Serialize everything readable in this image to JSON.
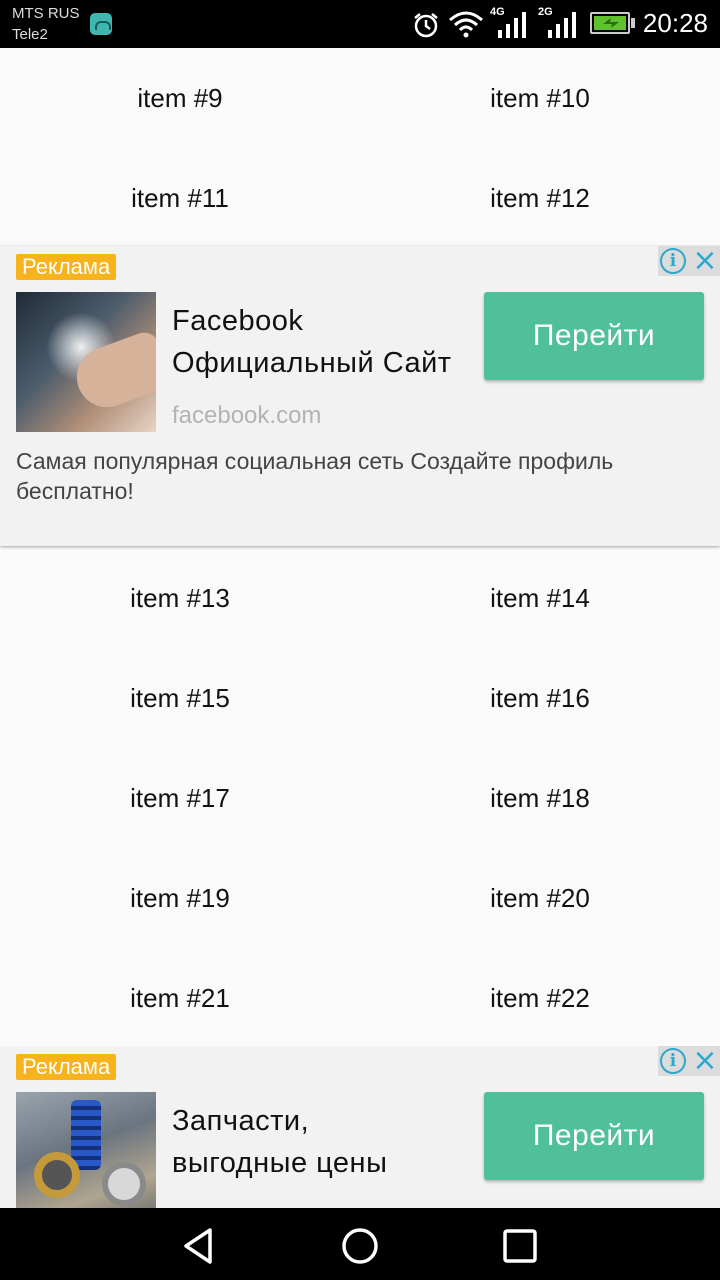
{
  "status_bar": {
    "carrier_primary": "MTS RUS",
    "carrier_secondary": "Tele2",
    "network_1": "4G",
    "network_2": "2G",
    "time": "20:28",
    "icons": [
      "android-notification-icon",
      "alarm-icon",
      "wifi-icon",
      "signal-icon",
      "battery-charging-icon"
    ]
  },
  "grid": {
    "rows_before_ad1": [
      [
        "item #9",
        "item #10"
      ],
      [
        "item #11",
        "item #12"
      ]
    ],
    "rows_after_ad1": [
      [
        "item #13",
        "item #14"
      ],
      [
        "item #15",
        "item #16"
      ],
      [
        "item #17",
        "item #18"
      ],
      [
        "item #19",
        "item #20"
      ],
      [
        "item #21",
        "item #22"
      ]
    ]
  },
  "ads": [
    {
      "label": "Реклама",
      "title_line1": "Facebook",
      "title_line2": "Официальный Сайт",
      "domain": "facebook.com",
      "cta": "Перейти",
      "description": "Самая популярная социальная сеть Создайте профиль бесплатно!"
    },
    {
      "label": "Реклама",
      "title_line1": "Запчасти,",
      "title_line2": "выгодные цены",
      "cta": "Перейти"
    }
  ],
  "colors": {
    "ad_label_bg": "#f6b31b",
    "cta_bg": "#4fc09a",
    "info_icon": "#2aa8d0",
    "page_bg": "#fafafa"
  },
  "nav_bar": {
    "icons": [
      "back-icon",
      "home-icon",
      "recents-icon"
    ]
  }
}
